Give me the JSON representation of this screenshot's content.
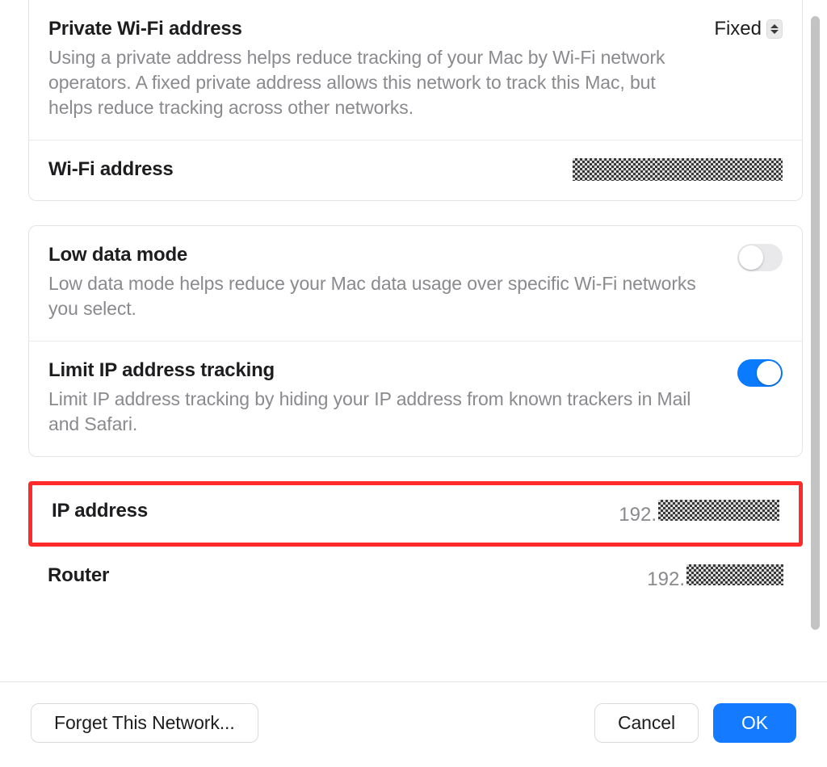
{
  "sections": {
    "privateWifi": {
      "title": "Private Wi-Fi address",
      "desc": "Using a private address helps reduce tracking of your Mac by Wi-Fi network operators. A fixed private address allows this network to track this Mac, but helps reduce tracking across other networks.",
      "value": "Fixed"
    },
    "wifiAddress": {
      "title": "Wi-Fi address"
    },
    "lowData": {
      "title": "Low data mode",
      "desc": "Low data mode helps reduce your Mac data usage over specific Wi-Fi networks you select.",
      "enabled": false
    },
    "limitTracking": {
      "title": "Limit IP address tracking",
      "desc": "Limit IP address tracking by hiding your IP address from known trackers in Mail and Safari.",
      "enabled": true
    },
    "ipAddress": {
      "title": "IP address",
      "prefix": "192."
    },
    "router": {
      "title": "Router",
      "prefix": "192."
    }
  },
  "footer": {
    "forget": "Forget This Network...",
    "cancel": "Cancel",
    "ok": "OK"
  }
}
